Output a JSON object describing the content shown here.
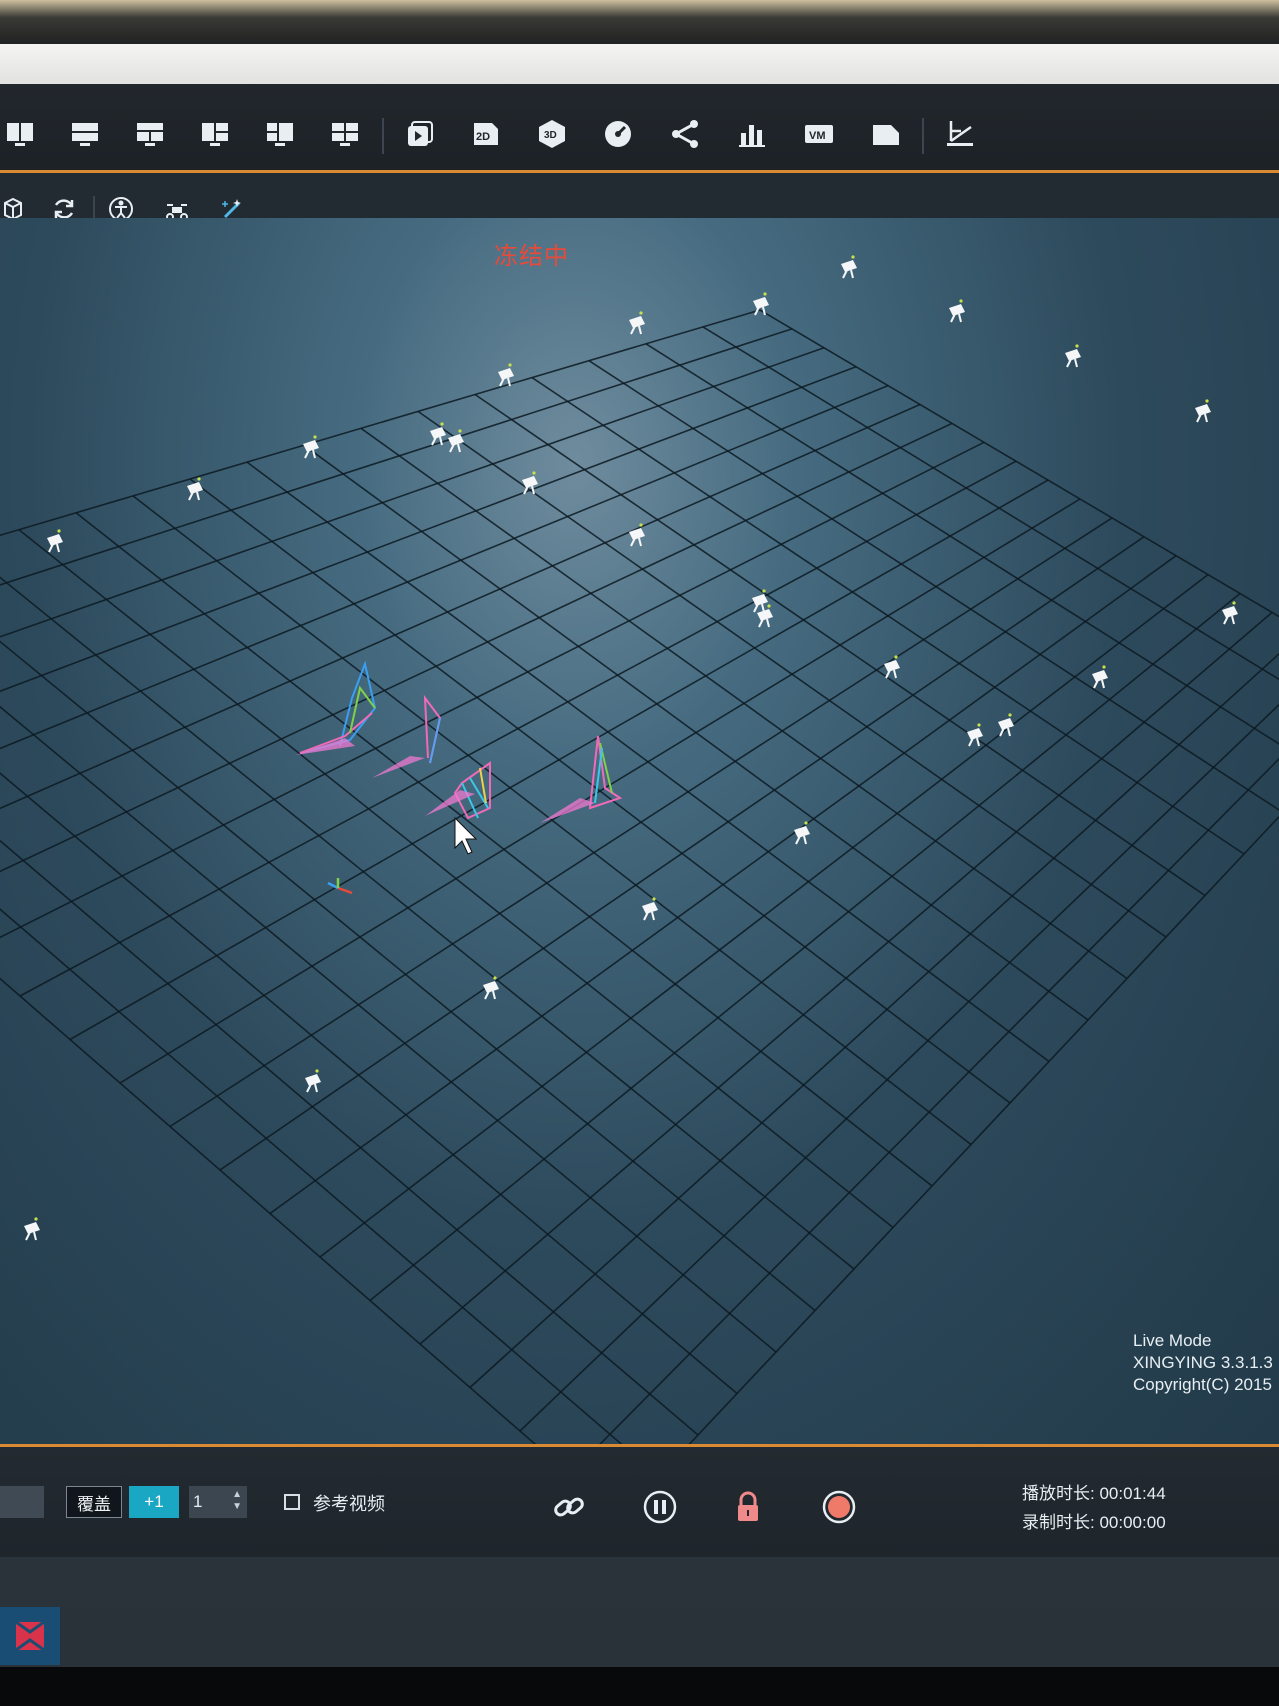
{
  "toolbar": {
    "icons": [
      "layout-1-icon",
      "layout-2-icon",
      "layout-3-icon",
      "layout-4-icon",
      "layout-5-icon",
      "layout-6-icon",
      "playback-icon",
      "view-2d-icon",
      "view-3d-icon",
      "gauge-icon",
      "skeleton-icon",
      "bar-chart-icon",
      "vm-icon",
      "folder-icon",
      "calibration-icon"
    ],
    "view_2d": "2D",
    "view_3d": "3D",
    "vm": "VM"
  },
  "subbar": {
    "icons": [
      "cube-icon",
      "refresh-icon",
      "body-icon",
      "drone-icon",
      "wand-icon"
    ]
  },
  "viewport": {
    "status": "冻结中",
    "mode": "Live Mode",
    "version": "XINGYING 3.3.1.3",
    "copyright": "Copyright(C) 2015"
  },
  "controls": {
    "cover_label": "覆盖",
    "plus_label": "+1",
    "spin_value": "1",
    "reference_video_label": "参考视频",
    "icons": [
      "link-icon",
      "pause-icon",
      "lock-icon",
      "record-icon"
    ]
  },
  "timers": {
    "playback_label": "播放时长:",
    "playback_value": "00:01:44",
    "record_label": "录制时长:",
    "record_value": "00:00:00"
  },
  "colors": {
    "accent": "#d98a32",
    "freeze_red": "#e84a3a",
    "plus_button": "#1aa7c4",
    "lock_icon": "#f08a8a"
  }
}
